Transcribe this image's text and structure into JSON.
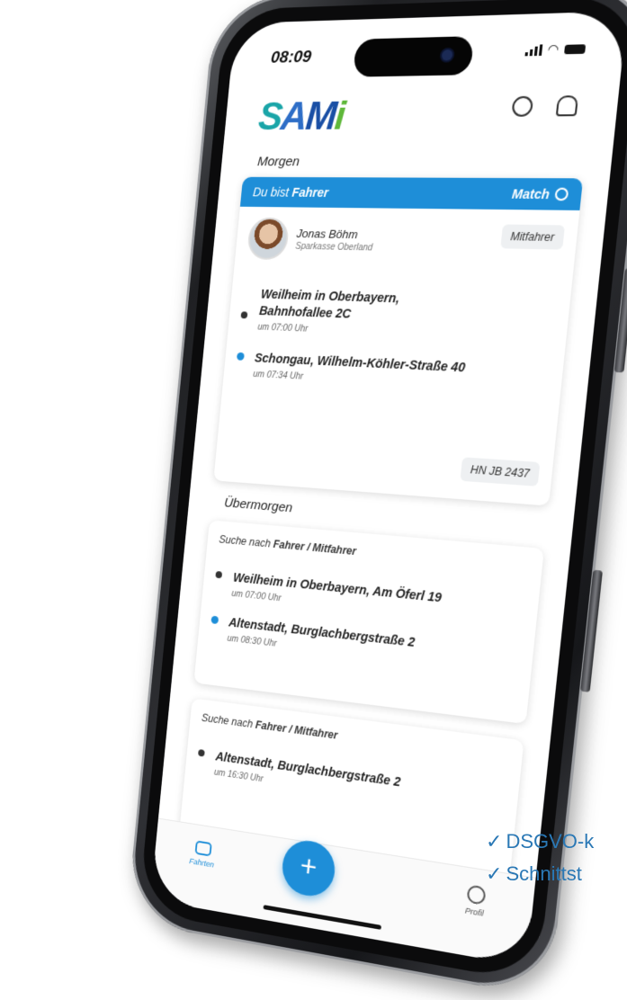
{
  "status": {
    "time": "08:09"
  },
  "logo": {
    "text_s": "S",
    "text_a": "A",
    "text_m": "M",
    "text_i": "i"
  },
  "header": {
    "icons": [
      "history-icon",
      "bell-icon"
    ]
  },
  "sections": {
    "tomorrow": "Morgen",
    "day_after": "Übermorgen"
  },
  "match_card": {
    "banner_prefix": "Du bist",
    "banner_role": "Fahrer",
    "match_label": "Match",
    "person_name": "Jonas Böhm",
    "person_org": "Sparkasse Oberland",
    "role_badge": "Mitfahrer",
    "from_line1": "Weilheim in Oberbayern,",
    "from_line2": "Bahnhofallee 2C",
    "from_time": "um 07:00 Uhr",
    "to_place": "Schongau, Wilhelm-Köhler-Straße 40",
    "to_time": "um 07:34 Uhr",
    "plate": "HN JB 2437"
  },
  "search_card_1": {
    "title_prefix": "Suche nach",
    "title_roles": "Fahrer / Mitfahrer",
    "from_place": "Weilheim in Oberbayern, Am Öferl 19",
    "from_time": "um 07:00 Uhr",
    "to_place": "Altenstadt, Burglachbergstraße 2",
    "to_time": "um 08:30 Uhr"
  },
  "search_card_2": {
    "title_prefix": "Suche nach",
    "title_roles": "Fahrer / Mitfahrer",
    "from_place": "Altenstadt, Burglachbergstraße 2",
    "from_time": "um 16:30 Uhr"
  },
  "tabbar": {
    "tab_rides": "Fahrten",
    "tab_profile": "Profil",
    "fab_symbol": "+"
  },
  "features": [
    {
      "tick": "✓",
      "text": "DSGVO-k"
    },
    {
      "tick": "✓",
      "text": "Schnittst"
    }
  ],
  "colors": {
    "accent": "#1e8ed8",
    "feature_text": "#2a78b5"
  }
}
